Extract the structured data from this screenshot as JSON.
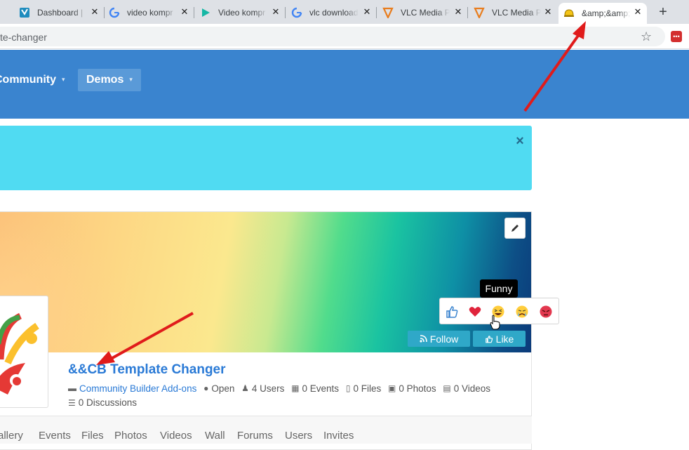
{
  "browser": {
    "tabs": [
      {
        "title": "Dashboard |",
        "icon": "yoast-icon"
      },
      {
        "title": "video kompr",
        "icon": "google-icon"
      },
      {
        "title": "Video kompr",
        "icon": "play-icon"
      },
      {
        "title": "vlc download",
        "icon": "google-icon"
      },
      {
        "title": "VLC Media P",
        "icon": "vlc-icon"
      },
      {
        "title": "VLC Media P",
        "icon": "vlc-icon"
      },
      {
        "title": "&amp;&amp;",
        "icon": "hardhat-icon"
      }
    ],
    "new_tab": "+",
    "close_glyph": "✕",
    "url": "te-changer",
    "star": "☆",
    "extension": "•••"
  },
  "navbar": {
    "items": [
      "Community",
      "Demos"
    ],
    "caret": "▾"
  },
  "alert": {
    "close": "×"
  },
  "group": {
    "title": "&&CB Template Changer",
    "category": "Community Builder Add-ons",
    "privacy": "Open",
    "users": "4 Users",
    "events": "0 Events",
    "files": "0 Files",
    "photos": "0 Photos",
    "videos": "0 Videos",
    "discussions": "0 Discussions",
    "follow_label": "Follow",
    "like_label": "Like"
  },
  "reactions": {
    "tooltip": "Funny",
    "items": [
      "like",
      "love",
      "funny",
      "sad",
      "angry"
    ]
  },
  "group_tabs": [
    "allery",
    "Events",
    "Files",
    "Photos",
    "Videos",
    "Wall",
    "Forums",
    "Users",
    "Invites"
  ],
  "colors": {
    "navbar": "#3a84cf",
    "alert": "#50dbf2",
    "link": "#2a7ad6",
    "button": "#2fa8c8",
    "arrow": "#e01b1b"
  }
}
